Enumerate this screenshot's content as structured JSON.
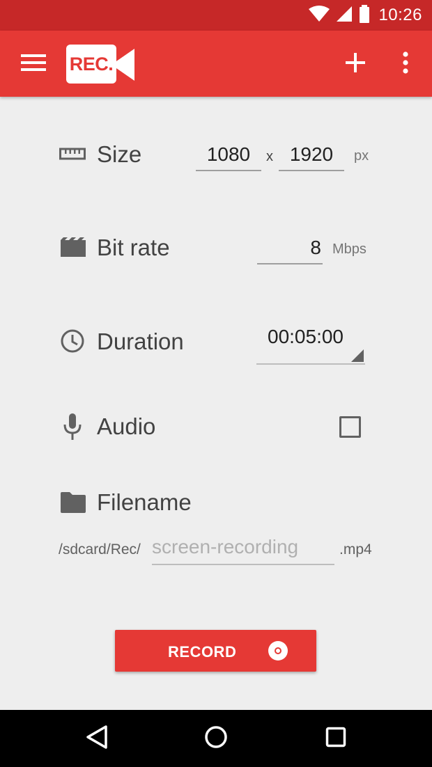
{
  "status_bar": {
    "time": "10:26",
    "icons": [
      "wifi-icon",
      "signal-icon",
      "battery-icon"
    ]
  },
  "app_bar": {
    "logo_text": "REC.",
    "actions": [
      "menu-icon",
      "add-icon",
      "more-vert-icon"
    ]
  },
  "settings": {
    "size": {
      "label": "Size",
      "icon": "ruler-icon",
      "width": "1080",
      "separator": "x",
      "height": "1920",
      "unit": "px"
    },
    "bitrate": {
      "label": "Bit rate",
      "icon": "clapperboard-icon",
      "value": "8",
      "unit": "Mbps"
    },
    "duration": {
      "label": "Duration",
      "icon": "clock-icon",
      "value": "00:05:00"
    },
    "audio": {
      "label": "Audio",
      "icon": "microphone-icon",
      "checked": false
    },
    "filename": {
      "label": "Filename",
      "icon": "folder-icon",
      "prefix": "/sdcard/Rec/",
      "placeholder": "screen-recording",
      "suffix": ".mp4"
    }
  },
  "record_button": {
    "label": "RECORD",
    "icon": "record-icon"
  },
  "nav_bar": {
    "buttons": [
      "back-icon",
      "home-icon",
      "recents-icon"
    ]
  },
  "colors": {
    "primary": "#e53935",
    "primary_dark": "#c62828",
    "background": "#eeeeee"
  }
}
